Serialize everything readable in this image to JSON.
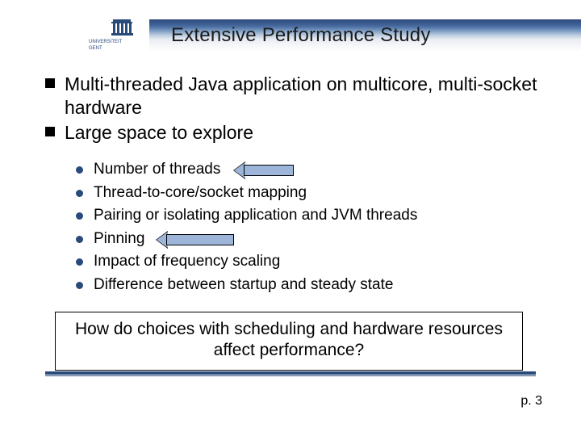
{
  "title": "Extensive Performance Study",
  "bullets": {
    "main": [
      "Multi-threaded Java application on multicore, multi-socket hardware",
      "Large space to explore"
    ],
    "sub": [
      "Number of threads",
      "Thread-to-core/socket mapping",
      "Pairing or isolating application and JVM threads",
      "Pinning",
      "Impact of frequency scaling",
      "Difference between startup and steady state"
    ]
  },
  "callout": "How do choices with scheduling and hardware resources affect performance?",
  "page_label": "p. 3",
  "logo_text_top": "UNIVERSITEIT",
  "logo_text_bottom": "GENT"
}
